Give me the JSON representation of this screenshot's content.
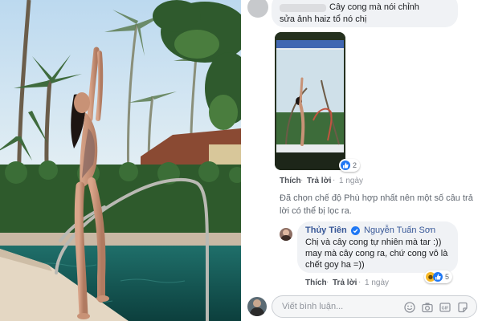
{
  "comments": [
    {
      "lines": [
        "Cây cong mà nói chỉnh",
        "sửa ảnh haiz tổ nó chị"
      ]
    },
    {
      "actions": {
        "like": "Thích",
        "reply": "Trả lời"
      },
      "time": "1 ngày",
      "reaction_count": "2"
    },
    {
      "author": "Thủy Tiên",
      "reply_to": "Nguyễn Tuấn Sơn",
      "lines": [
        "Chị và cây cong tự nhiên mà tar :))",
        "may mà cây cong ra, chứ cong vô là",
        "chết goy ha =))"
      ],
      "actions": {
        "like": "Thích",
        "reply": "Trả lời"
      },
      "time": "1 ngày",
      "reaction_count": "5"
    }
  ],
  "filter_notice": [
    "Đã chọn chế độ Phù hợp nhất nên một số câu trả",
    "lời có thể bị lọc ra."
  ],
  "composer": {
    "placeholder": "Viết bình luận..."
  },
  "colors": {
    "link_blue": "#385898",
    "bubble": "#f0f2f5",
    "like_blue": "#2078f4",
    "haha_yellow": "#f7b928"
  },
  "icons": [
    "verified-badge-icon",
    "like-reaction-icon",
    "haha-reaction-icon",
    "emoji-icon",
    "camera-icon",
    "gif-icon",
    "sticker-icon"
  ]
}
